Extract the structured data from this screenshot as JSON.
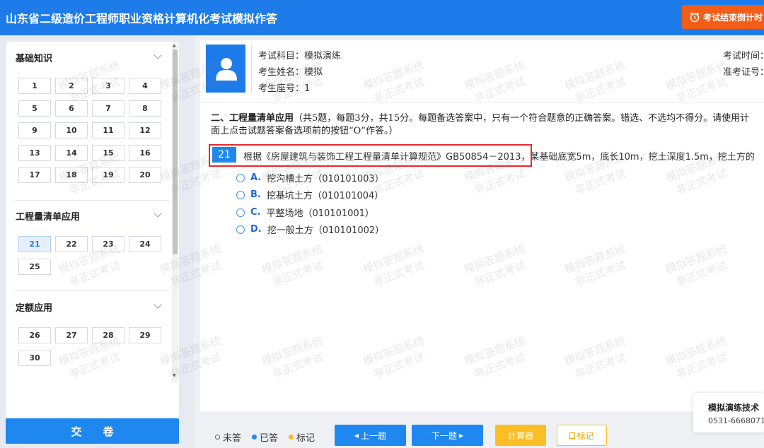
{
  "app": {
    "title": "山东省二级造价工程师职业资格计算机化考试模拟作答",
    "countdown_label": "考试结束倒计时"
  },
  "sidebar": {
    "sections": [
      {
        "title": "基础知识",
        "items": [
          "1",
          "2",
          "3",
          "4",
          "5",
          "6",
          "7",
          "8",
          "9",
          "10",
          "11",
          "12",
          "13",
          "14",
          "15",
          "16",
          "17",
          "18",
          "19",
          "20"
        ]
      },
      {
        "title": "工程量清单应用",
        "items": [
          "21",
          "22",
          "23",
          "24",
          "25"
        ],
        "current": "21"
      },
      {
        "title": "定额应用",
        "items": [
          "26",
          "27",
          "28",
          "29",
          "30"
        ]
      }
    ],
    "submit_label": "交卷"
  },
  "exam_info": {
    "subject": "考试科目：模拟演练",
    "name": "考生姓名：模拟",
    "seat": "考生座号：1",
    "time": "考试时间：",
    "ticket": "准考证号："
  },
  "section": {
    "heading_bold": "二、工程量清单应用",
    "heading_rest": "（共5题，每题3分，共15分。每题备选答案中，只有一个符合题意的正确答案。错选、不选均不得分。请使用计",
    "heading_line2": "面上点击试题答案备选项前的按钮“O”作答。）"
  },
  "question": {
    "number": "21",
    "text": "根据《房屋建筑与装饰工程工程量清单计算规范》GB50854－2013，某基础底宽5m，底长10m，挖土深度1.5m，挖土方的",
    "options": [
      {
        "letter": "A.",
        "text": "挖沟槽土方（010101003）"
      },
      {
        "letter": "B.",
        "text": "挖基坑土方（010101004）"
      },
      {
        "letter": "C.",
        "text": "平整场地（010101001）"
      },
      {
        "letter": "D.",
        "text": "挖一般土方（010101002）"
      }
    ]
  },
  "watermark": {
    "line1": "模拟答题系统",
    "line2": "非正式考试"
  },
  "contact": {
    "title": "模拟演练技术",
    "phone": "0531-6668071"
  },
  "legend": {
    "unanswered": "未答",
    "answered": "已答",
    "marked": "标记"
  },
  "nav": {
    "prev": "上一题",
    "next": "下一题",
    "calculator": "计算器",
    "mark": "标记"
  },
  "colors": {
    "primary": "#1e7cea",
    "accent_orange": "#f25d18",
    "highlight_red": "#e8282b",
    "marker_yellow": "#fbbf24"
  }
}
